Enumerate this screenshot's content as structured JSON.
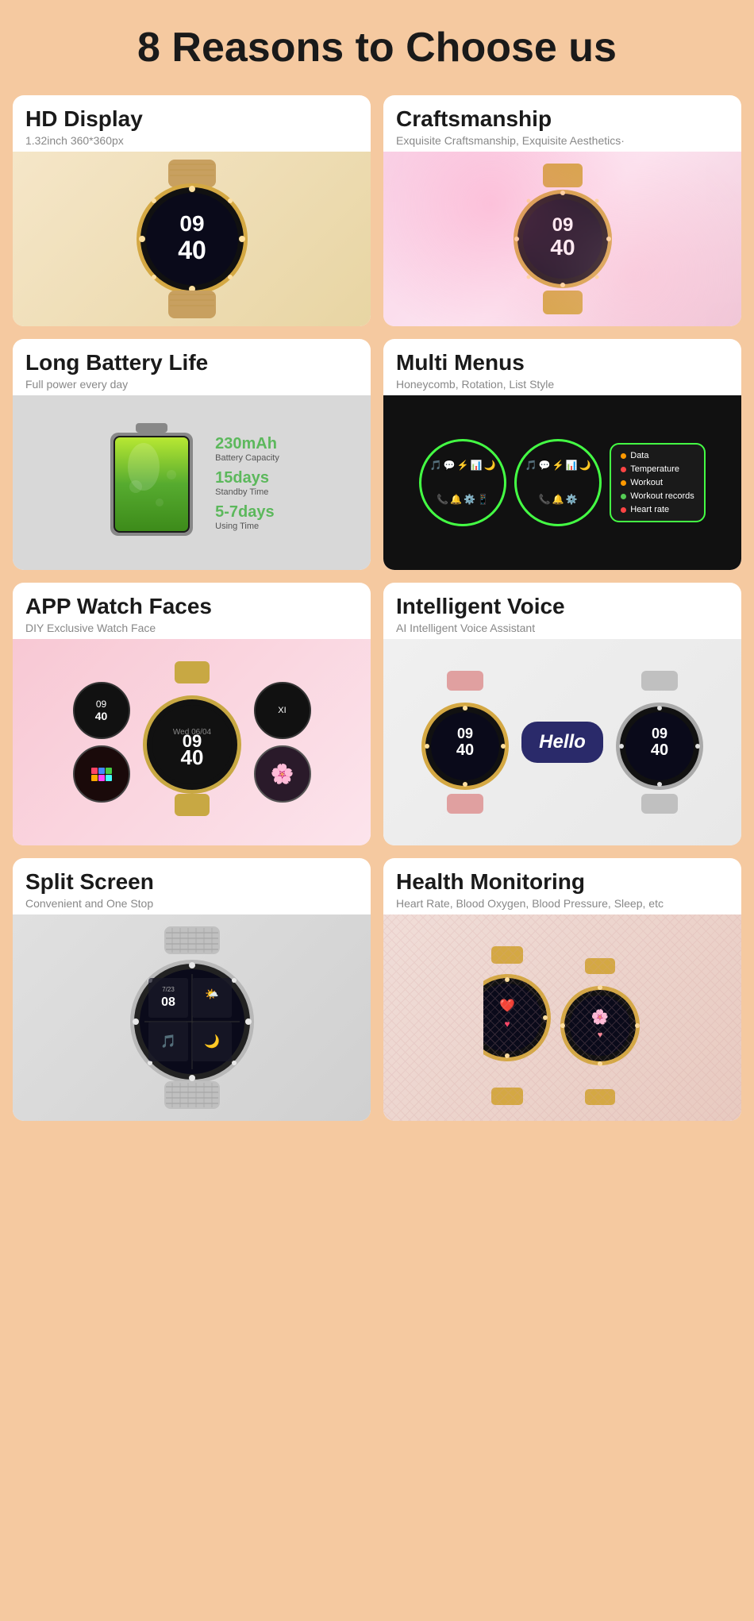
{
  "page": {
    "title": "8 Reasons to Choose us",
    "background_color": "#f5c9a0"
  },
  "cards": [
    {
      "id": "hd-display",
      "title": "HD Display",
      "subtitle": "1.32inch  360*360px",
      "image_type": "watch_gold",
      "bg_color": "#f0e0c0"
    },
    {
      "id": "craftsmanship",
      "title": "Craftsmanship",
      "subtitle": "Exquisite Craftsmanship, Exquisite Aesthetics·",
      "image_type": "watch_pink",
      "bg_color": "#f9e4ef"
    },
    {
      "id": "battery",
      "title": "Long Battery Life",
      "subtitle": "Full power every day",
      "image_type": "battery",
      "bg_color": "#d0d0d0",
      "stats": [
        {
          "value": "230mAh",
          "label": "Battery Capacity"
        },
        {
          "value": "15days",
          "label": "Standby Time"
        },
        {
          "value": "5-7days",
          "label": "Using Time"
        }
      ]
    },
    {
      "id": "multi-menus",
      "title": "Multi Menus",
      "subtitle": "Honeycomb, Rotation, List Style",
      "image_type": "menus",
      "bg_color": "#111111",
      "menu_items": [
        "Data",
        "Temperature",
        "Workout",
        "Workout records",
        "Heart rate"
      ]
    },
    {
      "id": "app-watch-faces",
      "title": "APP Watch Faces",
      "subtitle": "DIY Exclusive Watch Face",
      "image_type": "watch_faces",
      "bg_color": "#f8c8d4"
    },
    {
      "id": "intelligent-voice",
      "title": "Intelligent Voice",
      "subtitle": "AI Intelligent Voice Assistant",
      "image_type": "voice_watch",
      "bg_color": "#f0f0f0",
      "voice_label": "Hello"
    },
    {
      "id": "split-screen",
      "title": "Split Screen",
      "subtitle": "Convenient and One Stop",
      "image_type": "split_watch",
      "bg_color": "#e0e0e0"
    },
    {
      "id": "health-monitoring",
      "title": "Health Monitoring",
      "subtitle": "Heart Rate, Blood Oxygen, Blood Pressure, Sleep, etc",
      "image_type": "health_watch",
      "bg_color": "#f0ddd8"
    }
  ],
  "battery_stats": {
    "capacity_value": "230mAh",
    "capacity_label": "Battery Capacity",
    "standby_value": "15days",
    "standby_label": "Standby Time",
    "using_value": "5-7days",
    "using_label": "Using Time"
  },
  "menu_list_items": [
    "Data",
    "Temperature",
    "Workout",
    "Workout records",
    "Heart rate"
  ],
  "menu_dot_colors": [
    "#ff9900",
    "#ff4444",
    "#ff9900",
    "#55cc55",
    "#ff4444"
  ]
}
